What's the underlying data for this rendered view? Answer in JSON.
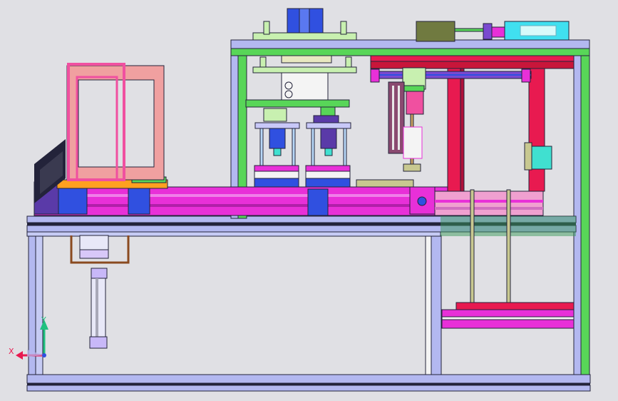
{
  "viewport": {
    "background": "#e0e0e4",
    "axis_triad": {
      "x_label": "X",
      "y_label": "Y"
    }
  },
  "colors": {
    "frame_blue": "#b3b8f0",
    "frame_dark": "#23233a",
    "green": "#58d658",
    "magenta": "#e830d8",
    "pink": "#f0a0a0",
    "hot_pink": "#f050a0",
    "red": "#e81a50",
    "crimson": "#c8163a",
    "purple": "#5a3aa8",
    "violet": "#7a4ad0",
    "blue": "#3050e0",
    "cyan": "#40e0d0",
    "olive": "#707a40",
    "orange": "#ffa020",
    "khaki": "#c8c890",
    "steel": "#8a8a9a",
    "brown": "#8a4a20",
    "light_green": "#c8f0b0",
    "teal": "#20c080"
  },
  "icons": [
    "axis-triad-icon"
  ]
}
